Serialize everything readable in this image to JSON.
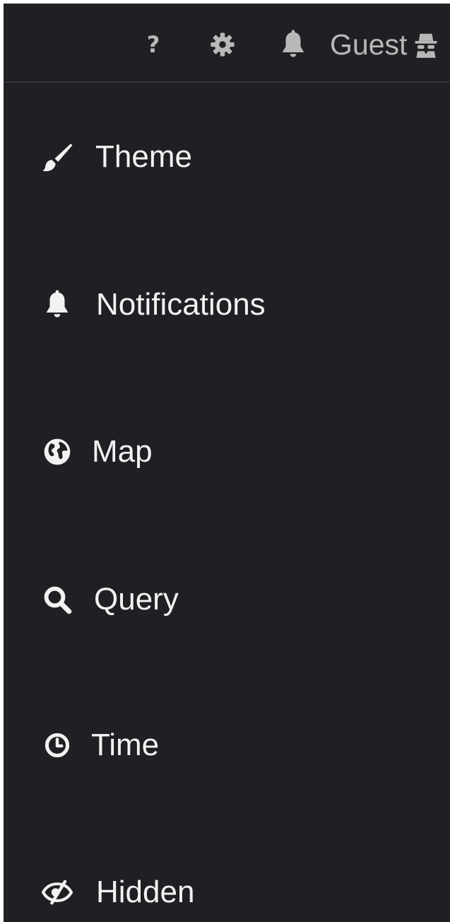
{
  "header": {
    "help_label": "?",
    "user_name": "Guest",
    "icons": [
      "help-icon",
      "gear-icon",
      "bell-icon",
      "incognito-user-icon"
    ]
  },
  "menu": {
    "items": [
      {
        "label": "Theme",
        "icon": "paintbrush-icon"
      },
      {
        "label": "Notifications",
        "icon": "bell-icon"
      },
      {
        "label": "Map",
        "icon": "globe-icon"
      },
      {
        "label": "Query",
        "icon": "search-icon"
      },
      {
        "label": "Time",
        "icon": "clock-icon"
      },
      {
        "label": "Hidden",
        "icon": "eye-slash-icon"
      }
    ]
  },
  "colors": {
    "background": "#202024",
    "header_icon": "#b8b8b8",
    "menu_text": "#f2f2f2",
    "divider": "#34343a"
  }
}
